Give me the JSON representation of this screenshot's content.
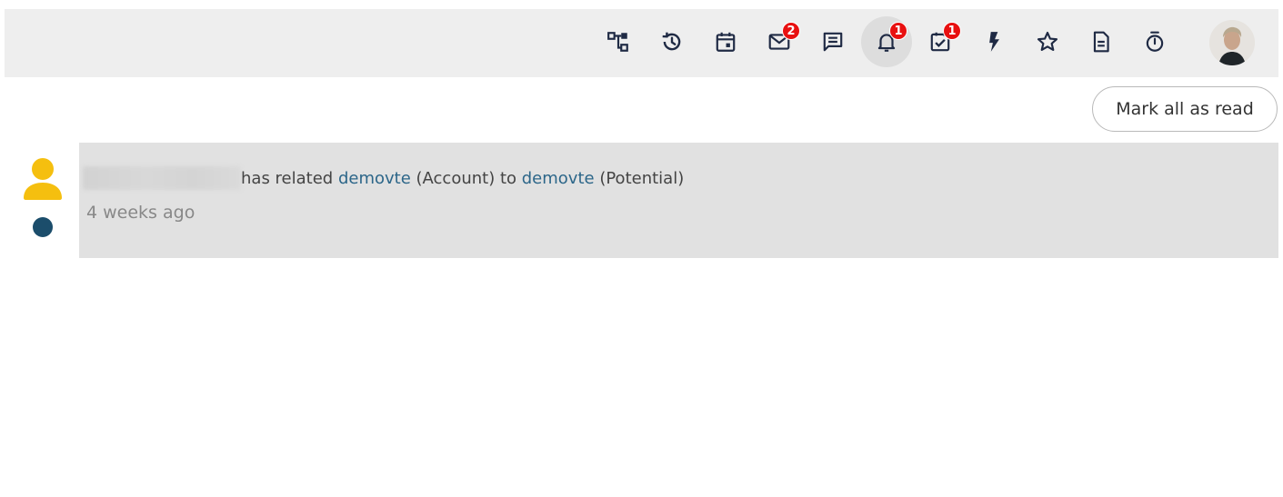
{
  "toolbar": {
    "icons": [
      {
        "name": "hierarchy-icon"
      },
      {
        "name": "history-icon"
      },
      {
        "name": "calendar-icon"
      },
      {
        "name": "mail-icon",
        "badge": "2"
      },
      {
        "name": "chat-icon"
      },
      {
        "name": "bell-icon",
        "badge": "1",
        "active": true
      },
      {
        "name": "task-check-icon",
        "badge": "1"
      },
      {
        "name": "lightning-icon"
      },
      {
        "name": "star-icon"
      },
      {
        "name": "document-icon"
      },
      {
        "name": "stopwatch-icon"
      }
    ],
    "avatar": "user-avatar"
  },
  "actions": {
    "mark_all_read": "Mark all as read"
  },
  "notifications": [
    {
      "text_part1": "has related ",
      "link1": "demovte",
      "text_part2": " (Account) to ",
      "link2": "demovte",
      "text_part3": " (Potential)",
      "time": "4 weeks ago",
      "unread": true
    }
  ],
  "colors": {
    "topbar_bg": "#eeeeee",
    "badge": "#e81010",
    "link": "#2c6689",
    "user_icon": "#f5bf0f",
    "unread_dot": "#1b4d6b",
    "notification_bg": "#e1e1e1"
  }
}
